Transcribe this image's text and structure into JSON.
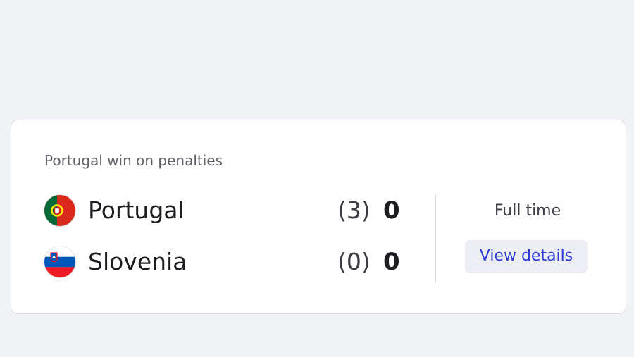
{
  "match": {
    "result_note": "Portugal win on penalties",
    "status": "Full time",
    "details_label": "View details",
    "teams": [
      {
        "name": "Portugal",
        "penalties": "(3)",
        "goals": "0",
        "flag_icon": "portugal-flag-icon",
        "flag_colors": [
          "#046a38",
          "#da291c",
          "#ffe900"
        ]
      },
      {
        "name": "Slovenia",
        "penalties": "(0)",
        "goals": "0",
        "flag_icon": "slovenia-flag-icon",
        "flag_colors": [
          "#ffffff",
          "#0057b8",
          "#ed1c24"
        ]
      }
    ]
  },
  "colors": {
    "page_background": "#f1f2f6",
    "card_background": "#ffffff",
    "link": "#2d3ad6",
    "button_background": "#edeef4"
  }
}
